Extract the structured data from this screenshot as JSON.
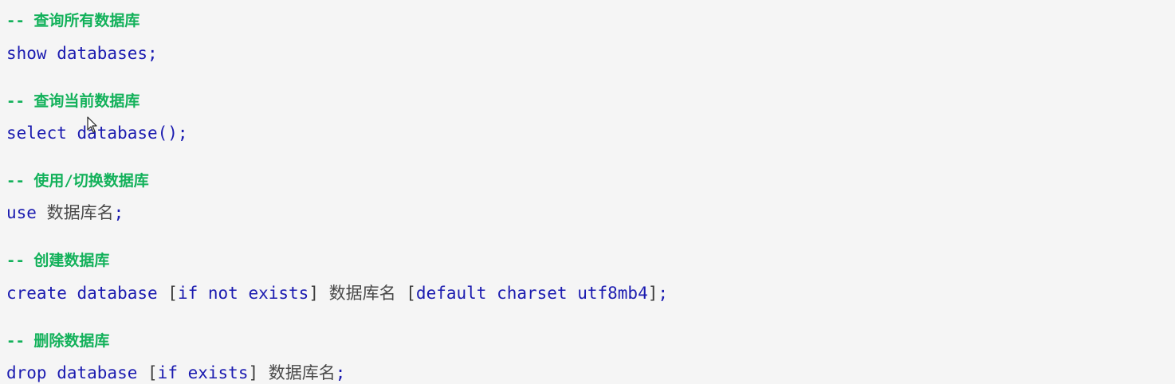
{
  "colors": {
    "background": "#f5f5f5",
    "comment": "#12b15a",
    "keyword": "#1b1bb0",
    "placeholder": "#4a4a4a"
  },
  "blocks": [
    {
      "comment": "-- 查询所有数据库",
      "code": {
        "kw1": "show databases;"
      }
    },
    {
      "comment": "-- 查询当前数据库",
      "code": {
        "kw1": "select database();"
      }
    },
    {
      "comment": "-- 使用/切换数据库",
      "code": {
        "kw1": "use ",
        "placeholder": "数据库名",
        "kw2": ";"
      }
    },
    {
      "comment": "-- 创建数据库",
      "code": {
        "kw1": "create database ",
        "b1": "[",
        "kw2": "if not exists",
        "b2": "] ",
        "placeholder": "数据库名",
        "b3": " [",
        "kw3": "default charset utf8mb4",
        "b4": "]",
        "kw4": ";"
      }
    },
    {
      "comment": "-- 删除数据库",
      "code": {
        "kw1": "drop database ",
        "b1": "[",
        "kw2": "if exists",
        "b2": "] ",
        "placeholder": "数据库名",
        "kw3": ";"
      }
    }
  ],
  "cursor_icon": "mouse-pointer-icon"
}
